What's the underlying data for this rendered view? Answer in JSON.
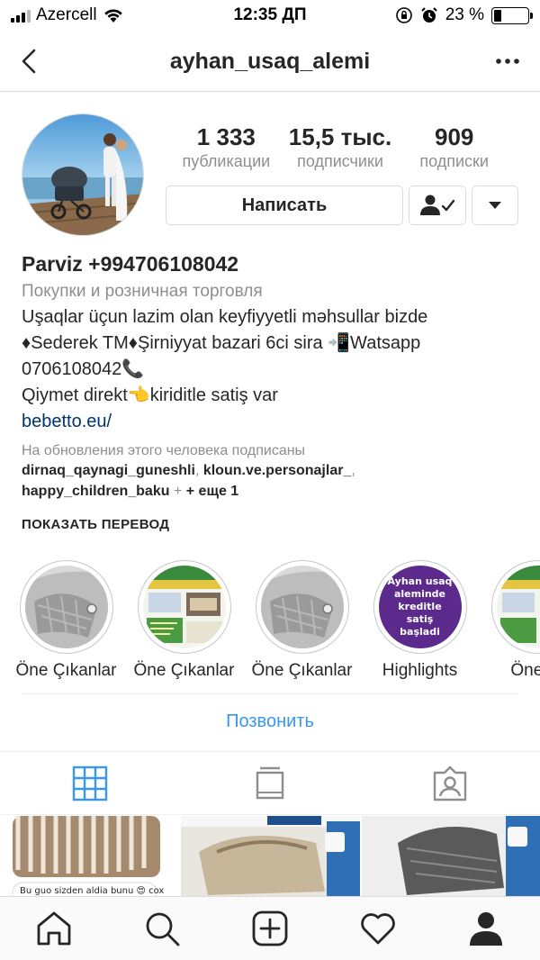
{
  "status_bar": {
    "carrier": "Azercell",
    "time": "12:35 ДП",
    "battery": "23 %",
    "battery_level": 0.23
  },
  "nav": {
    "title": "ayhan_usaq_alemi",
    "icons": {
      "back": "chevron-left-icon",
      "more": "more-horizontal-icon"
    }
  },
  "stats": {
    "posts": {
      "value": "1 333",
      "label": "публикации"
    },
    "followers": {
      "value": "15,5 тыс.",
      "label": "подписчики"
    },
    "following": {
      "value": "909",
      "label": "подписки"
    }
  },
  "buttons": {
    "message": "Написать",
    "following_icon": "person-check-icon",
    "more_icon": "caret-down-icon"
  },
  "bio": {
    "name": "Parviz +994706108042",
    "category": "Покупки и розничная торговля",
    "lines": [
      "Uşaqlar üçun lazim olan keyfiyyetli məhsullar bizde",
      "♦Sederek TM♦Şirniyyat bazari 6ci sira 📲Watsapp",
      "0706108042📞",
      "Qiymet direkt👈kiriditle satiş var"
    ],
    "link": "bebetto.eu/"
  },
  "followed_by": {
    "label": "На обновления этого человека подписаны",
    "names": [
      "dirnaq_qaynagi_guneshli",
      "kloun.ve.personajlar_",
      "happy_children_baku"
    ],
    "more": "+ еще 1"
  },
  "show_translation": "ПОКАЗАТЬ ПЕРЕВОД",
  "highlights": [
    {
      "label": "Öne Çıkanlar",
      "type": "photo-gray"
    },
    {
      "label": "Öne Çıkanlar",
      "type": "flyer"
    },
    {
      "label": "Öne Çıkanlar",
      "type": "photo-gray"
    },
    {
      "label": "Highlights",
      "type": "purple",
      "text": "Ayhan usaq aleminde kreditle satiş başladi"
    },
    {
      "label": "Öne Çı",
      "type": "flyer"
    }
  ],
  "call_button": "Позвонить",
  "grid_caption": "Bu guo sizden aldia bunu 😍 cox",
  "colors": {
    "link_blue": "#3897f0",
    "bio_link": "#003569",
    "secondary_text": "#8e8e8e",
    "highlight_purple": "#5b2a8c",
    "border": "#dbdbdb"
  },
  "tabs": [
    "grid-icon",
    "igtv-icon",
    "tagged-icon"
  ],
  "bottom_nav": [
    "home-icon",
    "search-icon",
    "add-post-icon",
    "heart-icon",
    "profile-icon"
  ]
}
